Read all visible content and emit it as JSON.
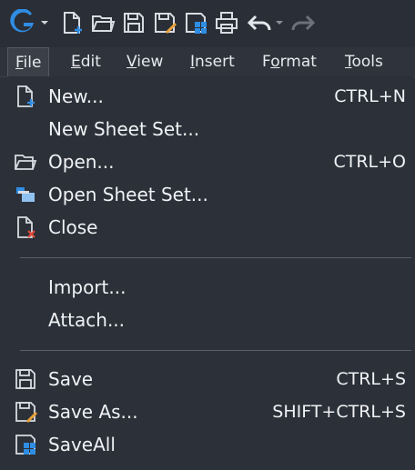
{
  "colors": {
    "background": "#2c3038",
    "text": "#f0f2f5",
    "brand_blue": "#2f8de4",
    "danger": "#e24a3b",
    "accent_orange": "#e8a13a"
  },
  "toolbar": {
    "icons": [
      "app-logo-icon",
      "new-file-icon",
      "open-folder-icon",
      "save-icon",
      "save-as-icon",
      "save-all-icon",
      "print-icon",
      "undo-icon",
      "redo-icon"
    ]
  },
  "menubar": {
    "items": [
      {
        "label": "File",
        "mnemonic": "F"
      },
      {
        "label": "Edit",
        "mnemonic": "E"
      },
      {
        "label": "View",
        "mnemonic": "V"
      },
      {
        "label": "Insert",
        "mnemonic": "I"
      },
      {
        "label": "Format",
        "mnemonic": "o"
      },
      {
        "label": "Tools",
        "mnemonic": "T"
      }
    ]
  },
  "file_menu": {
    "items": [
      {
        "label": "New...",
        "shortcut": "CTRL+N",
        "icon": "new-file-icon"
      },
      {
        "label": "New Sheet Set...",
        "shortcut": "",
        "icon": ""
      },
      {
        "label": "Open...",
        "shortcut": "CTRL+O",
        "icon": "open-folder-icon"
      },
      {
        "label": "Open Sheet Set...",
        "shortcut": "",
        "icon": "open-sheet-set-icon"
      },
      {
        "label": "Close",
        "shortcut": "",
        "icon": "close-file-icon"
      },
      {
        "label": "Import...",
        "shortcut": "",
        "icon": ""
      },
      {
        "label": "Attach...",
        "shortcut": "",
        "icon": ""
      },
      {
        "label": "Save",
        "shortcut": "CTRL+S",
        "icon": "save-icon"
      },
      {
        "label": "Save As...",
        "shortcut": "SHIFT+CTRL+S",
        "icon": "save-as-icon"
      },
      {
        "label": "SaveAll",
        "shortcut": "",
        "icon": "save-all-icon"
      }
    ]
  }
}
